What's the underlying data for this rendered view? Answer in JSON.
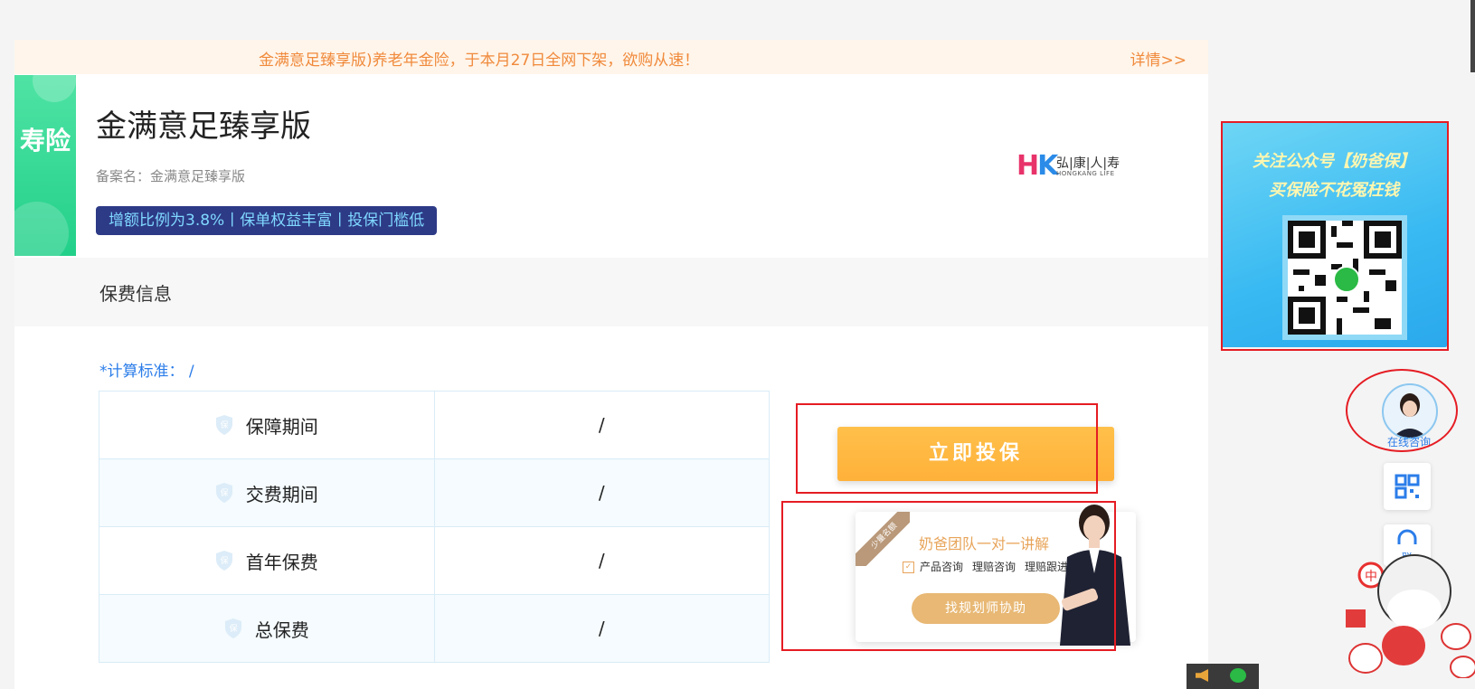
{
  "notice": {
    "text": "金满意足臻享版)养老年金险，于本月27日全网下架，欲购从速！",
    "more": "详情>>"
  },
  "product": {
    "category": "寿险",
    "name": "金满意足臻享版",
    "record_name": "备案名：金满意足臻享版",
    "highlight": "增额比例为3.8%丨保单权益丰富丨投保门槛低",
    "insurer_logo": {
      "cn": "弘|康|人|寿",
      "en": "HONGKANG LIFE",
      "mark_h": "H",
      "mark_k": "K"
    }
  },
  "premium_section": {
    "title": "保费信息",
    "calc_standard": "*计算标准： /",
    "rows": [
      {
        "label": "保障期间",
        "value": "/"
      },
      {
        "label": "交费期间",
        "value": "/"
      },
      {
        "label": "首年保费",
        "value": "/"
      },
      {
        "label": "总保费",
        "value": "/"
      }
    ],
    "shield_icon_text": "保"
  },
  "actions": {
    "buy": "立即投保"
  },
  "adviser": {
    "ribbon": "少量名额",
    "title": "奶爸团队一对一讲解",
    "items": [
      "产品咨询",
      "理赔咨询",
      "理赔跟进"
    ],
    "button": "找规划师协助"
  },
  "ad": {
    "line1": "关注公众号【奶爸保】",
    "line2": "买保险不花冤枉钱"
  },
  "float": {
    "consult": "在线咨询",
    "contact_partial": "联"
  },
  "colors": {
    "accent": "#ffb13a",
    "brand_green": "#22d08a",
    "notice": "#f08a3c",
    "link": "#2b7de9",
    "highlight_bg": "#2d3a86"
  }
}
